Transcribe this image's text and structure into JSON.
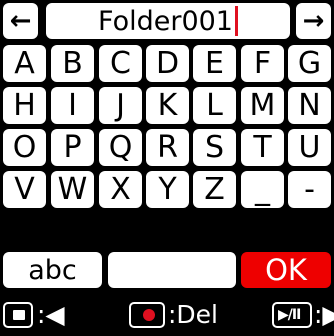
{
  "name_field": {
    "left_arrow": "←",
    "value": "Folder001",
    "right_arrow": "→"
  },
  "rows": [
    [
      "A",
      "B",
      "C",
      "D",
      "E",
      "F",
      "G"
    ],
    [
      "H",
      "I",
      "J",
      "K",
      "L",
      "M",
      "N"
    ],
    [
      "O",
      "P",
      "Q",
      "R",
      "S",
      "T",
      "U"
    ],
    [
      "V",
      "W",
      "X",
      "Y",
      "Z",
      "_",
      "-"
    ]
  ],
  "bottom_row": {
    "abc_label": "abc",
    "space_label": "",
    "ok_label": "OK"
  },
  "footer": {
    "left_hint": ":◀",
    "del_hint": ":Del",
    "playpause_icon_label": "▶/II",
    "right_hint": ":▶"
  },
  "colors": {
    "accent": "#ee0000",
    "background": "#000000",
    "key": "#ffffff"
  }
}
